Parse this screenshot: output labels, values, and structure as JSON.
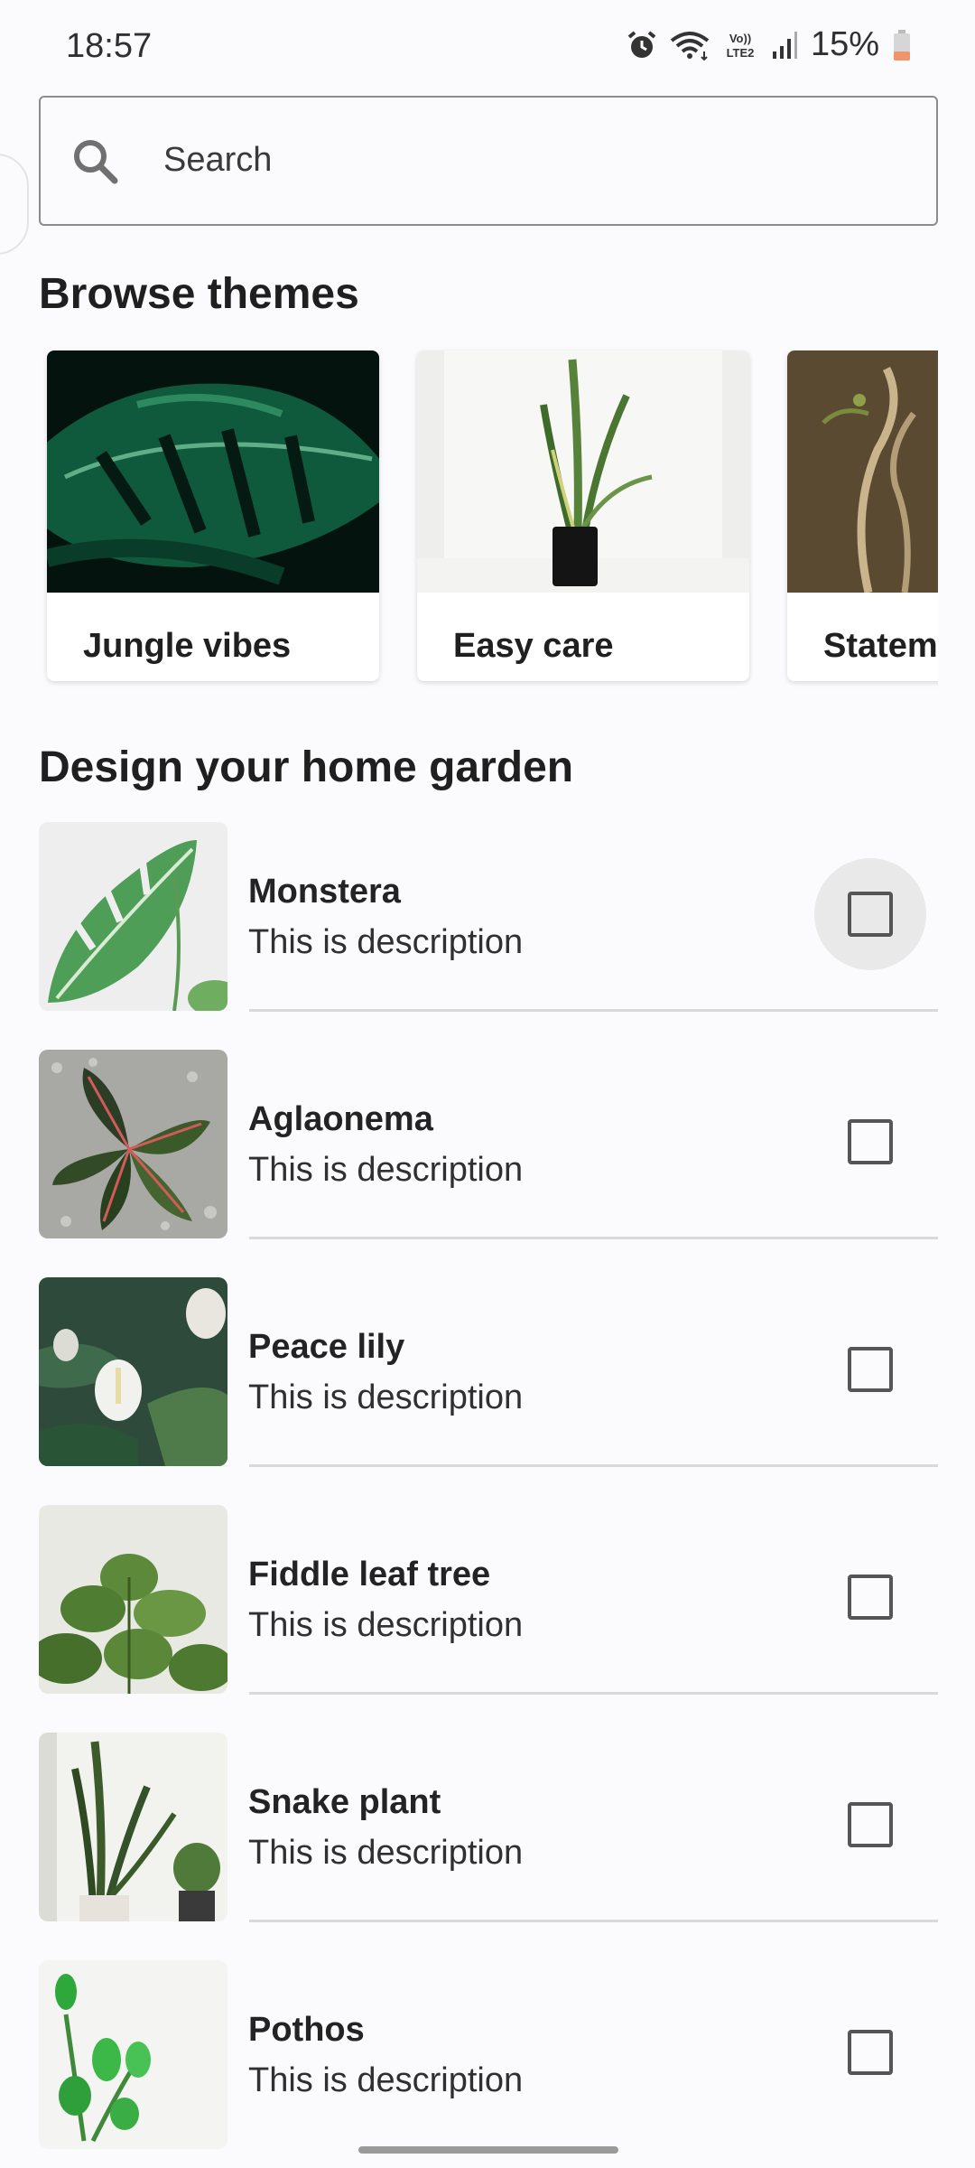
{
  "status_bar": {
    "time": "18:57",
    "battery": "15%",
    "network_label": "Vo)) LTE2",
    "icons": [
      "alarm-icon",
      "wifi-icon",
      "volte-icon",
      "signal-icon",
      "battery-icon"
    ]
  },
  "search": {
    "placeholder": "Search"
  },
  "browse": {
    "title": "Browse themes",
    "themes": [
      {
        "label": "Jungle vibes",
        "image": "monstera-leaf-photo"
      },
      {
        "label": "Easy care",
        "image": "snake-plant-photo"
      },
      {
        "label": "Statem",
        "image": "branches-photo"
      }
    ]
  },
  "garden": {
    "title": "Design your home garden",
    "plants": [
      {
        "name": "Monstera",
        "description": "This is description",
        "checked": false,
        "focused": true
      },
      {
        "name": "Aglaonema",
        "description": "This is description",
        "checked": false
      },
      {
        "name": "Peace lily",
        "description": "This is description",
        "checked": false
      },
      {
        "name": "Fiddle leaf tree",
        "description": "This is description",
        "checked": false
      },
      {
        "name": "Snake plant",
        "description": "This is description",
        "checked": false
      },
      {
        "name": "Pothos",
        "description": "This is description",
        "checked": false
      }
    ]
  },
  "colors": {
    "background": "#fbfbfd",
    "battery_low": "#f0956a",
    "checkbox_border": "#555555",
    "divider": "#d9d9d9"
  }
}
